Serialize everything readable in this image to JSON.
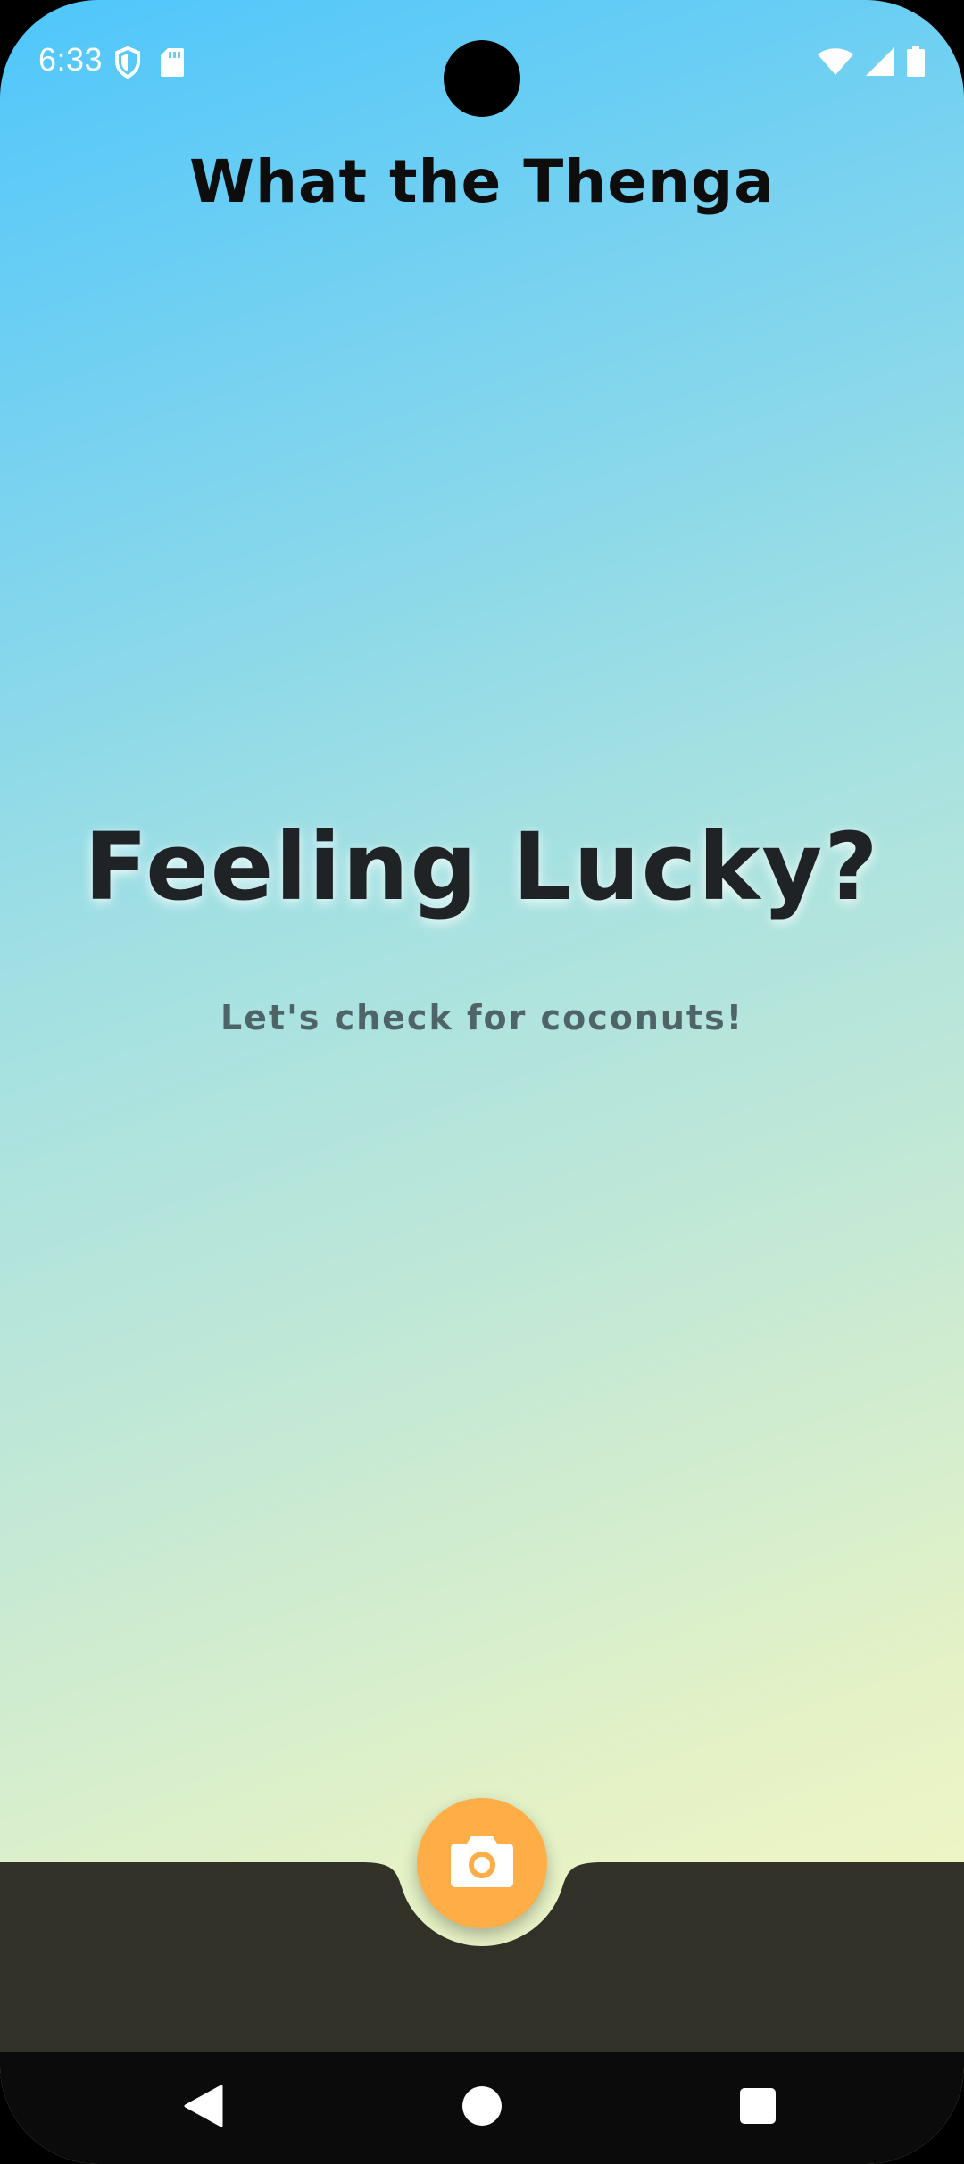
{
  "status_bar": {
    "time": "6:33",
    "icons_left": [
      "shield-icon",
      "sd-card-icon"
    ],
    "icons_right": [
      "wifi-icon",
      "cell-signal-icon",
      "battery-icon"
    ]
  },
  "app": {
    "title": "What the Thenga"
  },
  "hero": {
    "heading": "Feeling Lucky?",
    "subtitle": "Let's check for coconuts!"
  },
  "bottom_bar": {
    "fab_icon": "camera-icon"
  },
  "nav_bar": {
    "buttons": [
      "back-icon",
      "home-icon",
      "recents-icon"
    ]
  },
  "colors": {
    "gradient_top": "#4fc6fb",
    "gradient_bottom": "#fcf8c6",
    "bottom_bar": "#333228",
    "fab": "#ffad47",
    "nav_bar": "#0b0b0b"
  }
}
